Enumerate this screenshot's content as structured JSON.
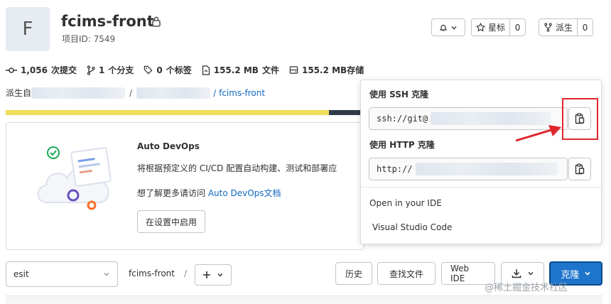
{
  "project": {
    "avatar_letter": "F",
    "name": "fcims-front",
    "id_text": "项目ID: 7549"
  },
  "header_actions": {
    "star_label": "星标",
    "star_count": "0",
    "fork_label": "派生",
    "fork_count": "0"
  },
  "stats": {
    "commits_count": "1,056",
    "commits_label": "次提交",
    "branches_count": "1",
    "branches_label": "个分支",
    "tags_count": "0",
    "tags_label": "个标签",
    "files_size": "155.2 MB",
    "files_label": "文件",
    "storage_size": "155.2 MB",
    "storage_label": "存储"
  },
  "forked": {
    "prefix": "派生自",
    "sep1": "/",
    "sep2": "/ ",
    "repo": "fcims-front"
  },
  "devops": {
    "title": "Auto DevOps",
    "description": "将根据预定义的 CI/CD 配置自动构建、测试和部署应",
    "more_prefix": "想了解更多请访问 ",
    "more_link": "Auto DevOps文档",
    "enable_button": "在设置中启用"
  },
  "clone_dropdown": {
    "ssh_label": "使用 SSH 克隆",
    "ssh_value": "ssh://git@",
    "http_label": "使用 HTTP 克隆",
    "http_value": "http://",
    "ide_heading": "Open in your IDE",
    "ide_option": "Visual Studio Code"
  },
  "toolbar": {
    "branch": "esit",
    "path_root": "fcims-front",
    "path_sep": "/",
    "history": "历史",
    "find_file": "查找文件",
    "web_ide": "Web IDE",
    "clone": "克隆"
  },
  "watermark": "@稀土掘金技术社区",
  "colors": {
    "primary": "#1f75cb",
    "link": "#1068bf",
    "annotation_red": "#e0262d",
    "progress_yellow": "#f0dc5a",
    "progress_dark": "#2e3a48"
  }
}
